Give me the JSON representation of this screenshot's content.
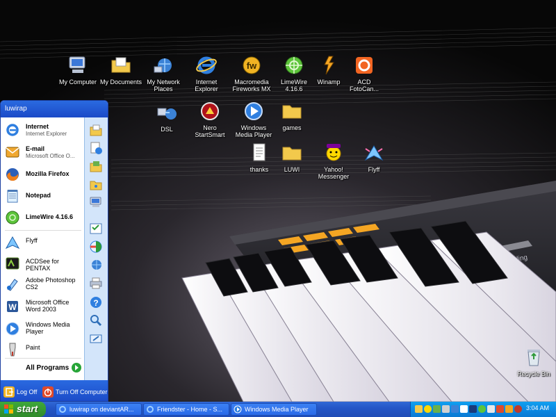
{
  "desktop": {
    "icons": [
      {
        "label": "My Computer",
        "icon": "my-computer-icon"
      },
      {
        "label": "My Documents",
        "icon": "my-documents-icon"
      },
      {
        "label": "My Network\nPlaces",
        "icon": "network-places-icon"
      },
      {
        "label": "Internet\nExplorer",
        "icon": "internet-explorer-icon"
      },
      {
        "label": "Macromedia\nFireworks MX",
        "icon": "fireworks-icon"
      },
      {
        "label": "LimeWire\n4.16.6",
        "icon": "limewire-icon"
      },
      {
        "label": "Winamp",
        "icon": "winamp-icon"
      },
      {
        "label": "ACD\nFotoCan...",
        "icon": "acd-fotocanvas-icon"
      },
      {
        "label": "DSL",
        "icon": "dsl-connection-icon"
      },
      {
        "label": "Nero\nStartSmart",
        "icon": "nero-icon"
      },
      {
        "label": "Windows\nMedia Player",
        "icon": "media-player-icon"
      },
      {
        "label": "games",
        "icon": "folder-icon"
      },
      {
        "label": "thanks",
        "icon": "text-document-icon"
      },
      {
        "label": "LUWI",
        "icon": "folder-icon"
      },
      {
        "label": "Yahoo!\nMessenger",
        "icon": "yahoo-messenger-icon"
      },
      {
        "label": "Flyff",
        "icon": "flyff-icon"
      },
      {
        "label": "Recycle Bin",
        "icon": "recycle-bin-icon"
      }
    ]
  },
  "start_menu": {
    "user": "luwirap",
    "pinned": [
      {
        "title": "Internet",
        "subtitle": "Internet Explorer",
        "icon": "internet-explorer-icon"
      },
      {
        "title": "E-mail",
        "subtitle": "Microsoft Office O...",
        "icon": "outlook-icon"
      },
      {
        "title": "Mozilla Firefox",
        "subtitle": "",
        "icon": "firefox-icon"
      },
      {
        "title": "Notepad",
        "subtitle": "",
        "icon": "notepad-icon"
      },
      {
        "title": "LimeWire 4.16.6",
        "subtitle": "",
        "icon": "limewire-icon"
      }
    ],
    "recent": [
      {
        "title": "Flyff",
        "icon": "flyff-icon"
      },
      {
        "title": "ACDSee for PENTAX",
        "icon": "acdsee-icon"
      },
      {
        "title": "Adobe Photoshop\nCS2",
        "icon": "photoshop-icon"
      },
      {
        "title": "Microsoft Office\nWord 2003",
        "icon": "word-icon"
      },
      {
        "title": "Windows Media\nPlayer",
        "icon": "media-player-icon"
      },
      {
        "title": "Paint",
        "icon": "paint-icon"
      }
    ],
    "all_programs": "All Programs",
    "right_icons": [
      "my-documents-icon",
      "my-recent-documents-icon",
      "my-pictures-icon",
      "my-music-icon",
      "my-computer-icon",
      "control-panel-icon",
      "set-program-access-icon",
      "connect-to-icon",
      "printers-icon",
      "help-icon",
      "search-icon",
      "run-icon"
    ],
    "log_off": "Log Off",
    "turn_off": "Turn Off Computer"
  },
  "taskbar": {
    "start": "start",
    "tasks": [
      {
        "label": "luwirap on deviantAR...",
        "icon": "internet-explorer-icon"
      },
      {
        "label": "Friendster - Home - S...",
        "icon": "internet-explorer-icon"
      },
      {
        "label": "Windows Media Player",
        "icon": "media-player-icon"
      }
    ],
    "tray_icons": [
      "network-icon",
      "yahoo-messenger-icon",
      "msn-icon",
      "antivirus-icon",
      "nero-icon",
      "security-icon",
      "volume-icon",
      "limewire-icon",
      "safely-remove-icon",
      "firewall-icon",
      "winamp-icon",
      "flyff-icon"
    ],
    "clock": "3:04 AM"
  },
  "colors": {
    "xp_blue": "#2456c7",
    "start_green": "#3fa83b",
    "tray_blue": "#0c8ae3",
    "key_orange": "#f5a623"
  }
}
